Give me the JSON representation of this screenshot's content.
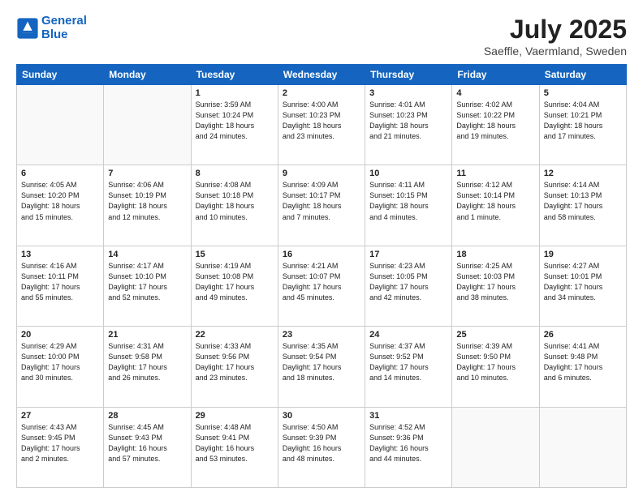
{
  "header": {
    "logo_line1": "General",
    "logo_line2": "Blue",
    "main_title": "July 2025",
    "sub_title": "Saeffle, Vaermland, Sweden"
  },
  "columns": [
    "Sunday",
    "Monday",
    "Tuesday",
    "Wednesday",
    "Thursday",
    "Friday",
    "Saturday"
  ],
  "weeks": [
    [
      {
        "day": "",
        "text": ""
      },
      {
        "day": "",
        "text": ""
      },
      {
        "day": "1",
        "text": "Sunrise: 3:59 AM\nSunset: 10:24 PM\nDaylight: 18 hours\nand 24 minutes."
      },
      {
        "day": "2",
        "text": "Sunrise: 4:00 AM\nSunset: 10:23 PM\nDaylight: 18 hours\nand 23 minutes."
      },
      {
        "day": "3",
        "text": "Sunrise: 4:01 AM\nSunset: 10:23 PM\nDaylight: 18 hours\nand 21 minutes."
      },
      {
        "day": "4",
        "text": "Sunrise: 4:02 AM\nSunset: 10:22 PM\nDaylight: 18 hours\nand 19 minutes."
      },
      {
        "day": "5",
        "text": "Sunrise: 4:04 AM\nSunset: 10:21 PM\nDaylight: 18 hours\nand 17 minutes."
      }
    ],
    [
      {
        "day": "6",
        "text": "Sunrise: 4:05 AM\nSunset: 10:20 PM\nDaylight: 18 hours\nand 15 minutes."
      },
      {
        "day": "7",
        "text": "Sunrise: 4:06 AM\nSunset: 10:19 PM\nDaylight: 18 hours\nand 12 minutes."
      },
      {
        "day": "8",
        "text": "Sunrise: 4:08 AM\nSunset: 10:18 PM\nDaylight: 18 hours\nand 10 minutes."
      },
      {
        "day": "9",
        "text": "Sunrise: 4:09 AM\nSunset: 10:17 PM\nDaylight: 18 hours\nand 7 minutes."
      },
      {
        "day": "10",
        "text": "Sunrise: 4:11 AM\nSunset: 10:15 PM\nDaylight: 18 hours\nand 4 minutes."
      },
      {
        "day": "11",
        "text": "Sunrise: 4:12 AM\nSunset: 10:14 PM\nDaylight: 18 hours\nand 1 minute."
      },
      {
        "day": "12",
        "text": "Sunrise: 4:14 AM\nSunset: 10:13 PM\nDaylight: 17 hours\nand 58 minutes."
      }
    ],
    [
      {
        "day": "13",
        "text": "Sunrise: 4:16 AM\nSunset: 10:11 PM\nDaylight: 17 hours\nand 55 minutes."
      },
      {
        "day": "14",
        "text": "Sunrise: 4:17 AM\nSunset: 10:10 PM\nDaylight: 17 hours\nand 52 minutes."
      },
      {
        "day": "15",
        "text": "Sunrise: 4:19 AM\nSunset: 10:08 PM\nDaylight: 17 hours\nand 49 minutes."
      },
      {
        "day": "16",
        "text": "Sunrise: 4:21 AM\nSunset: 10:07 PM\nDaylight: 17 hours\nand 45 minutes."
      },
      {
        "day": "17",
        "text": "Sunrise: 4:23 AM\nSunset: 10:05 PM\nDaylight: 17 hours\nand 42 minutes."
      },
      {
        "day": "18",
        "text": "Sunrise: 4:25 AM\nSunset: 10:03 PM\nDaylight: 17 hours\nand 38 minutes."
      },
      {
        "day": "19",
        "text": "Sunrise: 4:27 AM\nSunset: 10:01 PM\nDaylight: 17 hours\nand 34 minutes."
      }
    ],
    [
      {
        "day": "20",
        "text": "Sunrise: 4:29 AM\nSunset: 10:00 PM\nDaylight: 17 hours\nand 30 minutes."
      },
      {
        "day": "21",
        "text": "Sunrise: 4:31 AM\nSunset: 9:58 PM\nDaylight: 17 hours\nand 26 minutes."
      },
      {
        "day": "22",
        "text": "Sunrise: 4:33 AM\nSunset: 9:56 PM\nDaylight: 17 hours\nand 23 minutes."
      },
      {
        "day": "23",
        "text": "Sunrise: 4:35 AM\nSunset: 9:54 PM\nDaylight: 17 hours\nand 18 minutes."
      },
      {
        "day": "24",
        "text": "Sunrise: 4:37 AM\nSunset: 9:52 PM\nDaylight: 17 hours\nand 14 minutes."
      },
      {
        "day": "25",
        "text": "Sunrise: 4:39 AM\nSunset: 9:50 PM\nDaylight: 17 hours\nand 10 minutes."
      },
      {
        "day": "26",
        "text": "Sunrise: 4:41 AM\nSunset: 9:48 PM\nDaylight: 17 hours\nand 6 minutes."
      }
    ],
    [
      {
        "day": "27",
        "text": "Sunrise: 4:43 AM\nSunset: 9:45 PM\nDaylight: 17 hours\nand 2 minutes."
      },
      {
        "day": "28",
        "text": "Sunrise: 4:45 AM\nSunset: 9:43 PM\nDaylight: 16 hours\nand 57 minutes."
      },
      {
        "day": "29",
        "text": "Sunrise: 4:48 AM\nSunset: 9:41 PM\nDaylight: 16 hours\nand 53 minutes."
      },
      {
        "day": "30",
        "text": "Sunrise: 4:50 AM\nSunset: 9:39 PM\nDaylight: 16 hours\nand 48 minutes."
      },
      {
        "day": "31",
        "text": "Sunrise: 4:52 AM\nSunset: 9:36 PM\nDaylight: 16 hours\nand 44 minutes."
      },
      {
        "day": "",
        "text": ""
      },
      {
        "day": "",
        "text": ""
      }
    ]
  ]
}
